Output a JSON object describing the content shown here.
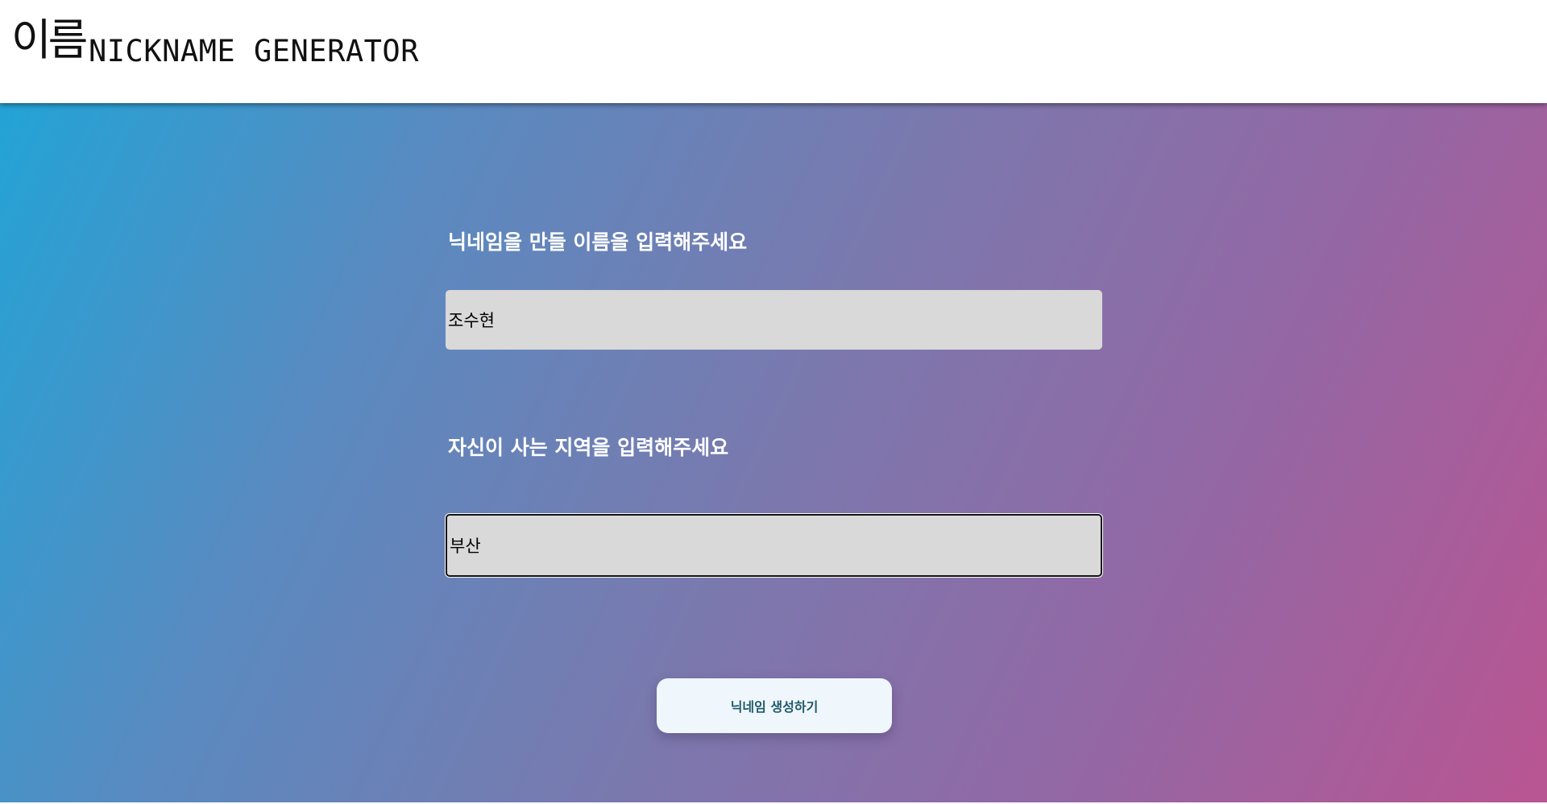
{
  "header": {
    "logo_text": "이름",
    "title": "NICKNAME GENERATOR"
  },
  "form": {
    "name_label": "닉네임을 만들 이름을 입력해주세요",
    "name_value": "조수현",
    "region_label": "자신이 사는 지역을 입력해주세요",
    "region_value": "부산",
    "generate_label": "닉네임 생성하기"
  },
  "colors": {
    "gradient_start": "#23a3d6",
    "gradient_end": "#b95592",
    "input_bg": "#d9d9d9",
    "button_bg": "#eff6fc",
    "button_text": "#1f5a6a"
  }
}
